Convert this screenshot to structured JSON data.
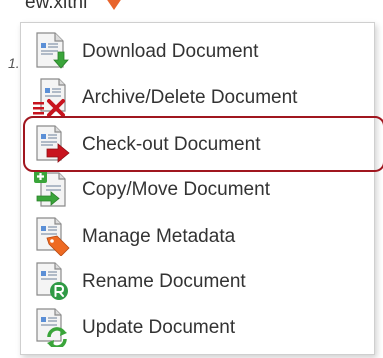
{
  "background": {
    "filename_fragment": "ew.xithi",
    "side_mark": "1."
  },
  "menu": {
    "items": [
      {
        "label": "Download Document",
        "icon": "download-document-icon"
      },
      {
        "label": "Archive/Delete Document",
        "icon": "archive-delete-document-icon"
      },
      {
        "label": "Check-out Document",
        "icon": "check-out-document-icon",
        "highlighted": true
      },
      {
        "label": "Copy/Move Document",
        "icon": "copy-move-document-icon"
      },
      {
        "label": "Manage Metadata",
        "icon": "manage-metadata-icon"
      },
      {
        "label": "Rename Document",
        "icon": "rename-document-icon"
      },
      {
        "label": "Update Document",
        "icon": "update-document-icon"
      }
    ]
  },
  "colors": {
    "highlight_border": "#a0161f",
    "badge_orange": "#e8642c",
    "arrow_green": "#3aa53a",
    "arrow_red": "#c8141e",
    "tag_orange": "#ee6a22",
    "badge_green": "#2f9a45"
  }
}
